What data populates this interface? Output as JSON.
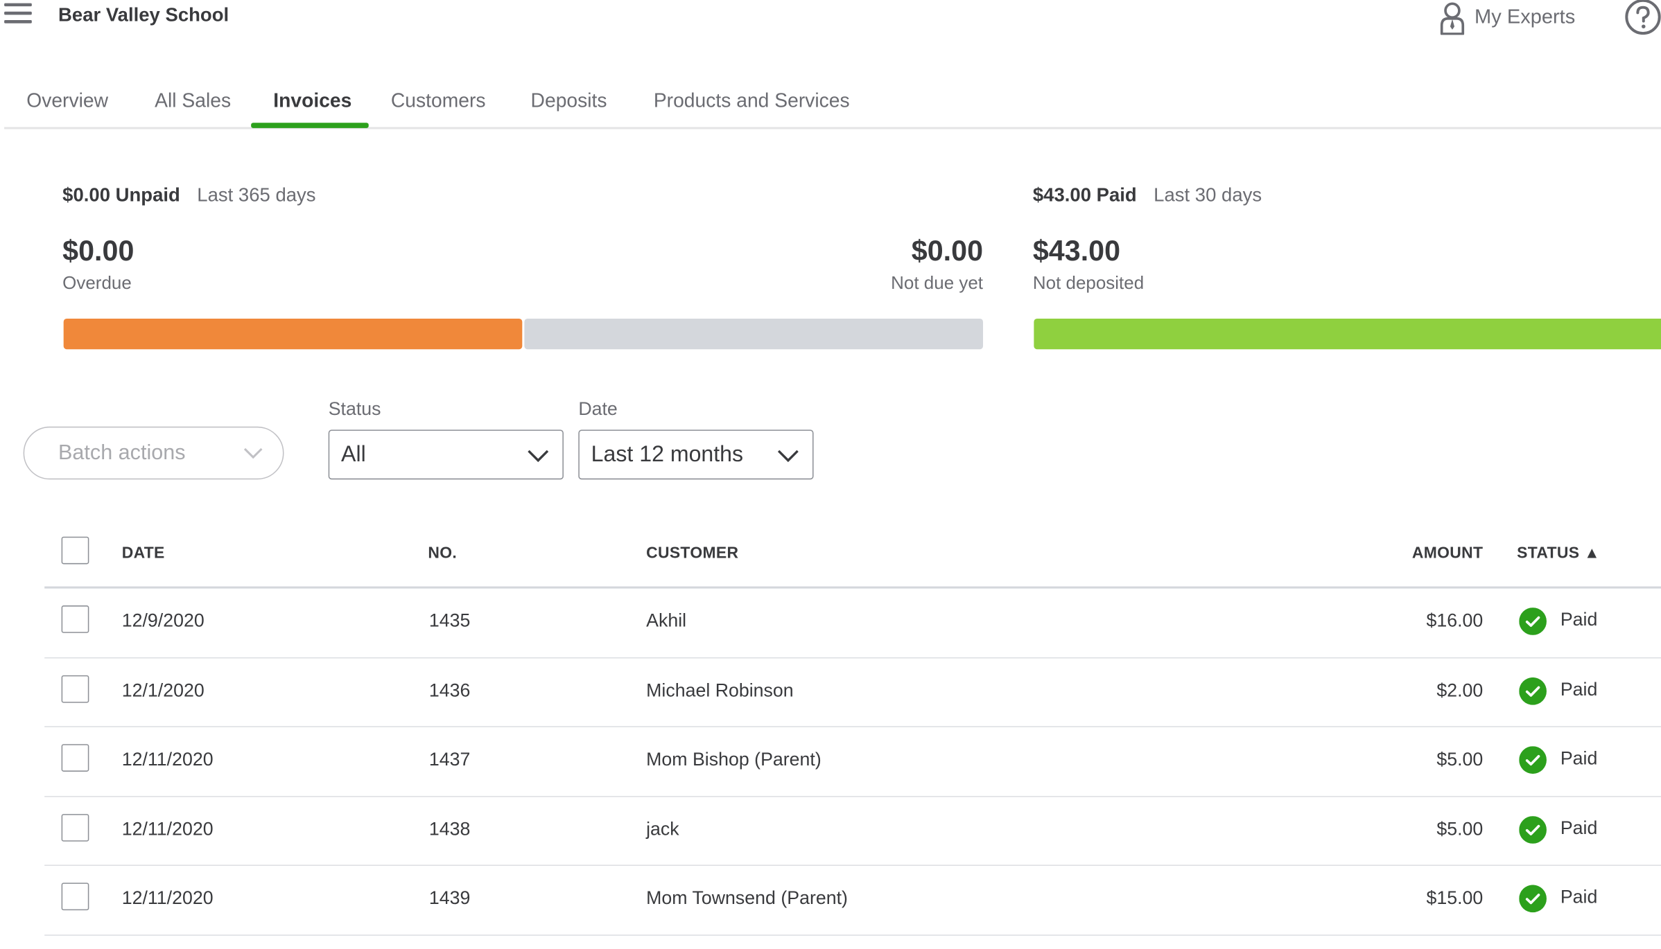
{
  "header": {
    "company": "Bear Valley School",
    "experts_label": "My Experts"
  },
  "tabs": [
    {
      "label": "Overview",
      "active": false
    },
    {
      "label": "All Sales",
      "active": false
    },
    {
      "label": "Invoices",
      "active": true
    },
    {
      "label": "Customers",
      "active": false
    },
    {
      "label": "Deposits",
      "active": false
    },
    {
      "label": "Products and Services",
      "active": false
    }
  ],
  "summary": {
    "unpaid": {
      "heading": "$0.00 Unpaid",
      "range": "Last 365 days",
      "overdue_amount": "$0.00",
      "overdue_label": "Overdue",
      "notdue_amount": "$0.00",
      "notdue_label": "Not due yet"
    },
    "paid": {
      "heading": "$43.00 Paid",
      "range": "Last 30 days",
      "amount": "$43.00",
      "label": "Not deposited"
    }
  },
  "colors": {
    "overdue": "#f0883a",
    "notdue": "#d4d7dc",
    "deposited": "#8fd03f",
    "accent": "#2ca01c"
  },
  "filters": {
    "batch_label": "Batch actions",
    "status_label": "Status",
    "status_value": "All",
    "date_label": "Date",
    "date_value": "Last 12 months"
  },
  "table": {
    "headers": {
      "date": "DATE",
      "no": "NO.",
      "customer": "CUSTOMER",
      "amount": "AMOUNT",
      "status": "STATUS ▲"
    },
    "rows": [
      {
        "date": "12/9/2020",
        "no": "1435",
        "customer": "Akhil",
        "amount": "$16.00",
        "status": "Paid"
      },
      {
        "date": "12/1/2020",
        "no": "1436",
        "customer": "Michael Robinson",
        "amount": "$2.00",
        "status": "Paid"
      },
      {
        "date": "12/11/2020",
        "no": "1437",
        "customer": "Mom Bishop (Parent)",
        "amount": "$5.00",
        "status": "Paid"
      },
      {
        "date": "12/11/2020",
        "no": "1438",
        "customer": "jack",
        "amount": "$5.00",
        "status": "Paid"
      },
      {
        "date": "12/11/2020",
        "no": "1439",
        "customer": "Mom Townsend (Parent)",
        "amount": "$15.00",
        "status": "Paid"
      }
    ]
  }
}
